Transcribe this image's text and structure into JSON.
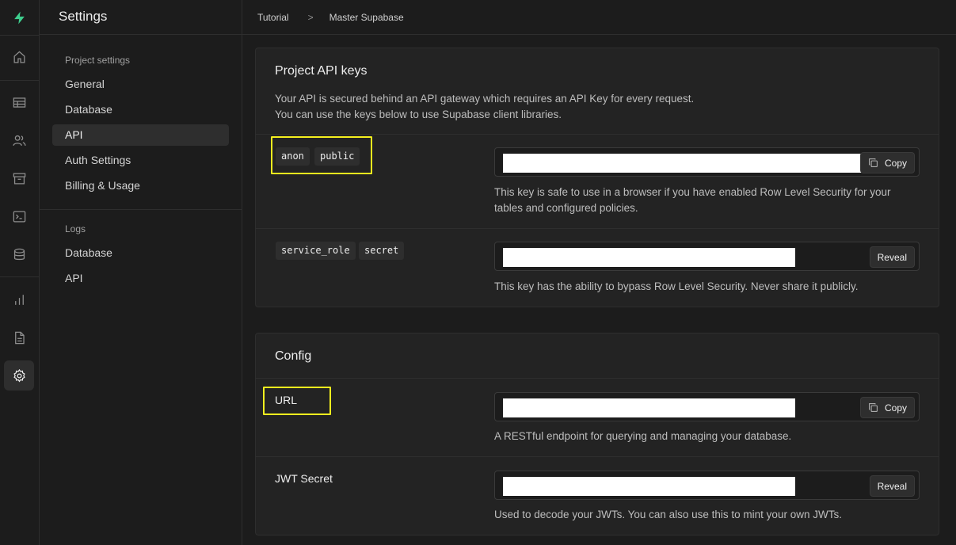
{
  "rail": {
    "items": [
      {
        "icon": "bolt-logo-icon"
      },
      {
        "icon": "home-icon"
      },
      {
        "icon": "table-editor-icon"
      },
      {
        "icon": "users-icon"
      },
      {
        "icon": "storage-icon"
      },
      {
        "icon": "terminal-icon"
      },
      {
        "icon": "database-icon"
      },
      {
        "icon": "reports-icon"
      },
      {
        "icon": "docs-icon"
      },
      {
        "icon": "settings-icon"
      }
    ],
    "brand_color": "#3ecf8e"
  },
  "sidebar": {
    "title": "Settings",
    "project_section_label": "Project settings",
    "project_items": [
      {
        "label": "General"
      },
      {
        "label": "Database"
      },
      {
        "label": "API",
        "active": true
      },
      {
        "label": "Auth Settings"
      },
      {
        "label": "Billing & Usage"
      }
    ],
    "logs_section_label": "Logs",
    "logs_items": [
      {
        "label": "Database"
      },
      {
        "label": "API"
      }
    ]
  },
  "breadcrumb": {
    "items": [
      "Tutorial",
      "Master Supabase"
    ],
    "separator": ">"
  },
  "api_keys": {
    "title": "Project API keys",
    "description_line1": "Your API is secured behind an API gateway which requires an API Key for every request.",
    "description_line2": "You can use the keys below to use Supabase client libraries.",
    "anon": {
      "tags": [
        "anon",
        "public"
      ],
      "button_label": "Copy",
      "help": "This key is safe to use in a browser if you have enabled Row Level Security for your tables and configured policies."
    },
    "service_role": {
      "tags": [
        "service_role",
        "secret"
      ],
      "button_label": "Reveal",
      "help": "This key has the ability to bypass Row Level Security. Never share it publicly."
    }
  },
  "config": {
    "title": "Config",
    "url": {
      "label": "URL",
      "button_label": "Copy",
      "help": "A RESTful endpoint for querying and managing your database."
    },
    "jwt": {
      "label": "JWT Secret",
      "button_label": "Reveal",
      "help": "Used to decode your JWTs. You can also use this to mint your own JWTs."
    }
  },
  "highlight_color": "#f5f01e"
}
